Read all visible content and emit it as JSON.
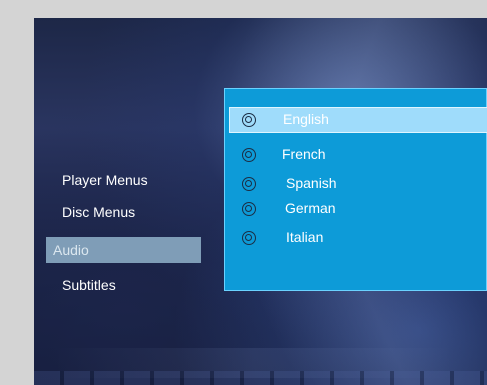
{
  "left_menu": {
    "items": [
      {
        "label": "Player Menus",
        "selected": false
      },
      {
        "label": "Disc Menus",
        "selected": false
      },
      {
        "label": "Audio",
        "selected": true
      },
      {
        "label": "Subtitles",
        "selected": false
      }
    ]
  },
  "audio_panel": {
    "options": [
      {
        "label": "English",
        "selected": true
      },
      {
        "label": "French",
        "selected": false
      },
      {
        "label": "Spanish",
        "selected": false
      },
      {
        "label": "German",
        "selected": false
      },
      {
        "label": "Italian",
        "selected": false
      }
    ]
  },
  "colors": {
    "panel_background": "#0d9bd8",
    "selected_option": "#9fdcfb",
    "selected_menu_item": "#7f9db7"
  }
}
